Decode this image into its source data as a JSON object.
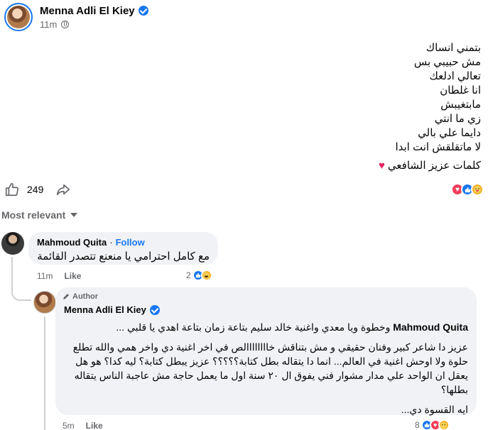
{
  "post": {
    "author": "Menna Adli El Kiey",
    "time": "11m",
    "lines": [
      "بتمني انساك",
      "مش حبيبي بس",
      "تعالي ادلعك",
      "انا غلطان",
      "مابتغيبش",
      "زي ما انتي",
      "دايما علي بالي",
      "لا ماتقلقش انت ابدا"
    ],
    "credit": "كلمات  عزيز الشافعي",
    "heart_emoji": "♥"
  },
  "actions": {
    "like_count": "249"
  },
  "sort_label": "Most relevant",
  "comments": [
    {
      "author": "Mahmoud Quita",
      "separator": "·",
      "follow_label": "Follow",
      "text": "مع كامل احترامي يا منعنع تتصدر القائمة",
      "time": "11m",
      "like_label": "Like",
      "reaction_count": "2"
    },
    {
      "badge": "Author",
      "author": "Menna Adli El Kiey",
      "mention": "Mahmoud Quita",
      "line1_rest": " وخطوة ويا معدي واغنية خالد سليم بتاعة زمان بتاعة اهدي يا قلبي ...",
      "paragraph2": "عزيز دا شاعر كبير وفنان حقيقي و مش بتناقش خاااااااالص في اخر اغنية دي واخر همي والله تطلع حلوة ولا اوحش اغنية في العالم... انما دا يتقاله بطل كتابة؟؟؟؟؟ عزيز يبطل كتابة؟ ليه كدا؟ هو هل يعقل ان الواحد علي مدار مشوار فني يفوق ال ٢٠ سنة اول ما يعمل حاجة مش عاجبة الناس يتقاله بطلها؟",
      "paragraph3": "ايه القسوة دي...",
      "time": "5m",
      "like_label": "Like",
      "reaction_count": "8"
    }
  ],
  "colors": {
    "accent": "#1877f2",
    "love": "#f33e58",
    "care": "#f7b125",
    "muted": "#65676b",
    "bubble": "#f0f2f5"
  }
}
